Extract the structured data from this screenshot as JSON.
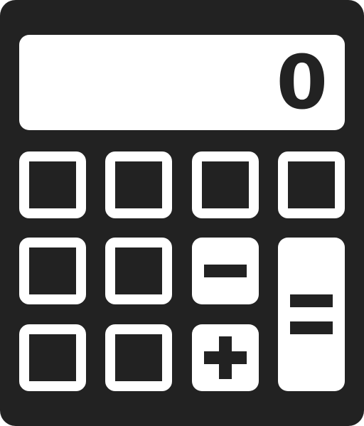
{
  "display": {
    "value": "0"
  },
  "colors": {
    "body": "#222222",
    "key_face": "#ffffff"
  },
  "keys": {
    "minus_icon": "minus-icon",
    "plus_icon": "plus-icon",
    "equals_icon": "equals-icon"
  }
}
